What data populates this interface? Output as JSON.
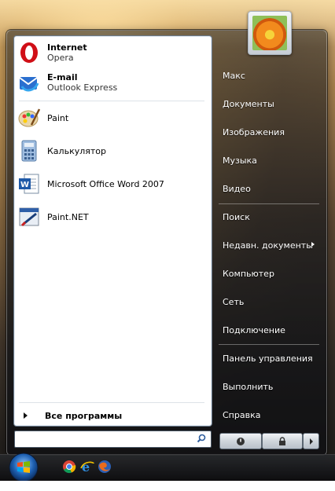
{
  "left_pane": {
    "pinned": [
      {
        "title": "Internet",
        "subtitle": "Opera",
        "icon": "opera-icon"
      },
      {
        "title": "E-mail",
        "subtitle": "Outlook Express",
        "icon": "outlook-express-icon"
      }
    ],
    "recent": [
      {
        "label": "Paint",
        "icon": "paint-icon"
      },
      {
        "label": "Калькулятор",
        "icon": "calculator-icon"
      },
      {
        "label": "Microsoft Office Word 2007",
        "icon": "word-icon"
      },
      {
        "label": "Paint.NET",
        "icon": "paintnet-icon"
      }
    ],
    "all_programs": "Все программы"
  },
  "search": {
    "value": "",
    "placeholder": ""
  },
  "right_pane": {
    "items": [
      "Макс",
      "Документы",
      "Изображения",
      "Музыка",
      "Видео",
      "Поиск",
      "Недавн. документы",
      "Компьютер",
      "Сеть",
      "Подключение",
      "Панель управления",
      "Выполнить",
      "Справка"
    ]
  },
  "colors": {
    "opera_red": "#d00f17",
    "pane_border": "#6c7b8b"
  }
}
